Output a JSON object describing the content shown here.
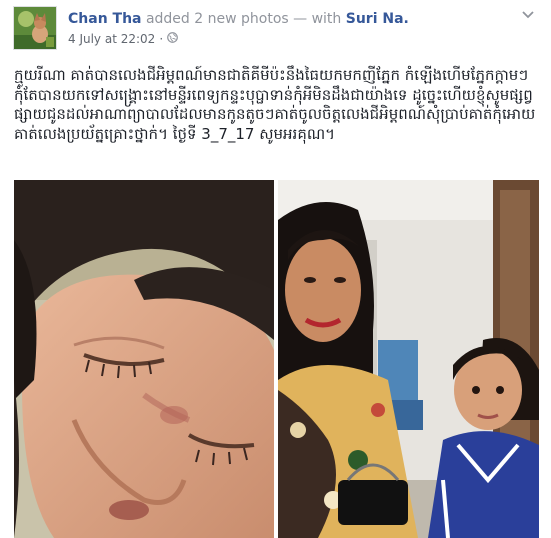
{
  "post": {
    "author": "Chan Tha",
    "action": "added 2 new photos",
    "with_sep": "— with",
    "tagged": "Suri Na.",
    "timestamp": "4 July at 22:02",
    "separator": "·",
    "privacy_icon": "globe-icon",
    "menu_icon": "chevron-down-icon",
    "text": "ក្មួយរីណា គាត់បានលេងជីអិម្ដពណ៍មានជាតិគីមីប៉ះនឹងធៃយកមកញីភ្នែក កំឡើងហើមភ្នែកក្ដាមៗ កុំតែបានយកទៅសង្គ្រោះនៅមន្ទីរពេទ្យកន្ទះបុប្ផាទាន់កុំអីមិនដឹងជាយ៉ាងទេ ដូច្នេះហើយខ្ញុំសូមផ្សព្វផ្សាយជូនដល់អាណាព្យាបាលដែលមានកូនតូចៗគាត់ចូលចិត្តលេងជីអិម្ដពណ៍សុំប្រាប់គាត់កុំអោយគាត់លេងប្រយ័ត្នគ្រោះថ្នាក់។ ថ្ងៃទី 3_7_17 សូមអរគុណ។"
  },
  "photos": [
    {
      "description_icon": "photo-child-eye-closeup"
    },
    {
      "description_icon": "photo-woman-and-child"
    }
  ]
}
